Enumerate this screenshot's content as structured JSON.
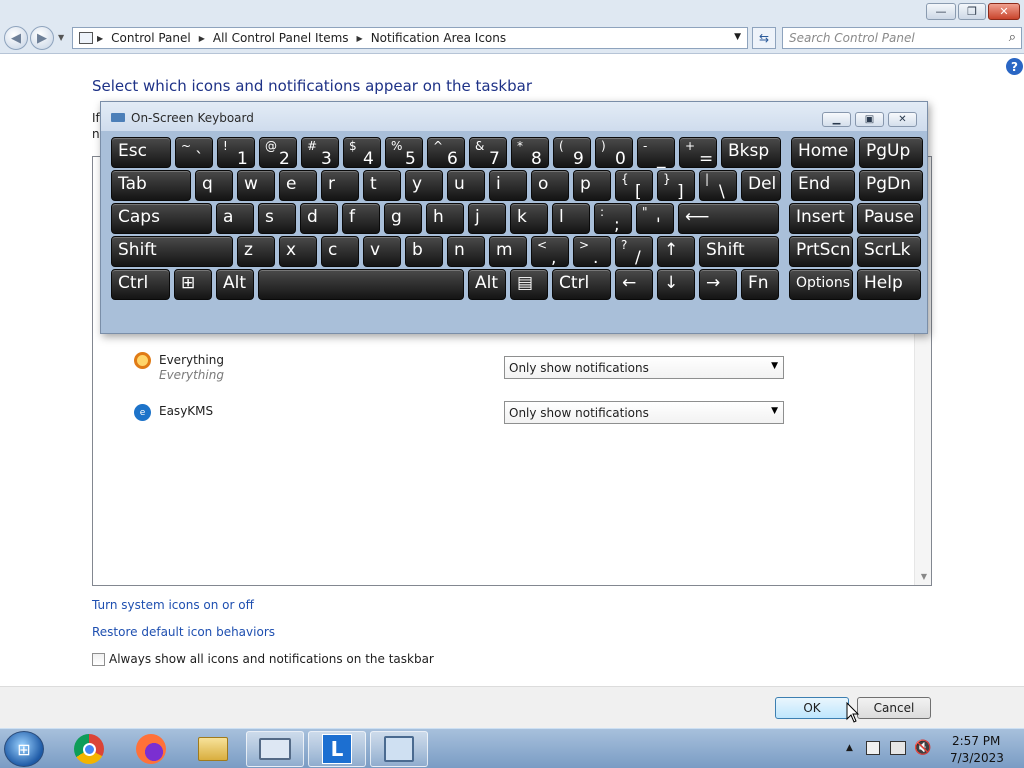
{
  "window": {
    "minimize_glyph": "—",
    "maximize_glyph": "❐",
    "close_glyph": "✕"
  },
  "nav": {
    "breadcrumbs": [
      "Control Panel",
      "All Control Panel Items",
      "Notification Area Icons"
    ],
    "search_placeholder": "Search Control Panel"
  },
  "main": {
    "heading": "Select which icons and notifications appear on the taskbar",
    "hidden_prefix_1": "If",
    "hidden_prefix_2": "n",
    "rows": [
      {
        "name": "Everything",
        "sub": "Everything",
        "behavior": "Only show notifications",
        "icon": "magnifier-icon"
      },
      {
        "name": "EasyKMS",
        "sub": "",
        "behavior": "Only show notifications",
        "icon": "easykms-icon"
      }
    ],
    "links": {
      "system_icons": "Turn system icons on or off",
      "restore_defaults": "Restore default icon behaviors"
    },
    "always_show_label": "Always show all icons and notifications on the taskbar",
    "always_show_checked": false
  },
  "footer": {
    "ok_label": "OK",
    "cancel_label": "Cancel"
  },
  "osk": {
    "title": "On-Screen Keyboard",
    "rows": [
      [
        {
          "l": "Esc",
          "w": 60
        },
        {
          "t": "~",
          "b": "`",
          "w": 38
        },
        {
          "t": "!",
          "b": "1",
          "w": 38
        },
        {
          "t": "@",
          "b": "2",
          "w": 38
        },
        {
          "t": "#",
          "b": "3",
          "w": 38
        },
        {
          "t": "$",
          "b": "4",
          "w": 38
        },
        {
          "t": "%",
          "b": "5",
          "w": 38
        },
        {
          "t": "^",
          "b": "6",
          "w": 38
        },
        {
          "t": "&",
          "b": "7",
          "w": 38
        },
        {
          "t": "*",
          "b": "8",
          "w": 38
        },
        {
          "t": "(",
          "b": "9",
          "w": 38
        },
        {
          "t": ")",
          "b": "0",
          "w": 38
        },
        {
          "t": "-",
          "b": "_",
          "w": 38
        },
        {
          "t": "+",
          "b": "=",
          "w": 38
        },
        {
          "l": "Bksp",
          "w": 60
        },
        {
          "l": "Home",
          "w": 64,
          "gap": 6
        },
        {
          "l": "PgUp",
          "w": 64
        }
      ],
      [
        {
          "l": "Tab",
          "w": 80
        },
        {
          "l": "q",
          "w": 38
        },
        {
          "l": "w",
          "w": 38
        },
        {
          "l": "e",
          "w": 38
        },
        {
          "l": "r",
          "w": 38
        },
        {
          "l": "t",
          "w": 38
        },
        {
          "l": "y",
          "w": 38
        },
        {
          "l": "u",
          "w": 38
        },
        {
          "l": "i",
          "w": 38
        },
        {
          "l": "o",
          "w": 38
        },
        {
          "l": "p",
          "w": 38
        },
        {
          "t": "{",
          "b": "[",
          "w": 38
        },
        {
          "t": "}",
          "b": "]",
          "w": 38
        },
        {
          "t": "|",
          "b": "\\",
          "w": 38
        },
        {
          "l": "Del",
          "w": 40
        },
        {
          "l": "End",
          "w": 64,
          "gap": 6
        },
        {
          "l": "PgDn",
          "w": 64
        }
      ],
      [
        {
          "l": "Caps",
          "w": 101
        },
        {
          "l": "a",
          "w": 38
        },
        {
          "l": "s",
          "w": 38
        },
        {
          "l": "d",
          "w": 38
        },
        {
          "l": "f",
          "w": 38
        },
        {
          "l": "g",
          "w": 38
        },
        {
          "l": "h",
          "w": 38
        },
        {
          "l": "j",
          "w": 38
        },
        {
          "l": "k",
          "w": 38
        },
        {
          "l": "l",
          "w": 38
        },
        {
          "t": ":",
          "b": ";",
          "w": 38
        },
        {
          "t": "\"",
          "b": "'",
          "w": 38
        },
        {
          "l": "⟵",
          "w": 101
        },
        {
          "l": "Insert",
          "w": 64,
          "gap": 6
        },
        {
          "l": "Pause",
          "w": 64
        }
      ],
      [
        {
          "l": "Shift",
          "w": 122
        },
        {
          "l": "z",
          "w": 38
        },
        {
          "l": "x",
          "w": 38
        },
        {
          "l": "c",
          "w": 38
        },
        {
          "l": "v",
          "w": 38
        },
        {
          "l": "b",
          "w": 38
        },
        {
          "l": "n",
          "w": 38
        },
        {
          "l": "m",
          "w": 38
        },
        {
          "t": "<",
          "b": ",",
          "w": 38
        },
        {
          "t": ">",
          "b": ".",
          "w": 38
        },
        {
          "t": "?",
          "b": "/",
          "w": 38
        },
        {
          "l": "↑",
          "w": 38
        },
        {
          "l": "Shift",
          "w": 80
        },
        {
          "l": "PrtScn",
          "w": 64,
          "gap": 6
        },
        {
          "l": "ScrLk",
          "w": 64
        }
      ],
      [
        {
          "l": "Ctrl",
          "w": 59
        },
        {
          "l": "⊞",
          "w": 38
        },
        {
          "l": "Alt",
          "w": 38
        },
        {
          "l": "",
          "w": 206
        },
        {
          "l": "Alt",
          "w": 38
        },
        {
          "l": "▤",
          "w": 38
        },
        {
          "l": "Ctrl",
          "w": 59
        },
        {
          "l": "←",
          "w": 38
        },
        {
          "l": "↓",
          "w": 38
        },
        {
          "l": "→",
          "w": 38
        },
        {
          "l": "Fn",
          "w": 38
        },
        {
          "l": "Options",
          "w": 64,
          "gap": 6,
          "small": true
        },
        {
          "l": "Help",
          "w": 64
        }
      ]
    ]
  },
  "taskbar": {
    "apps": [
      "chrome-icon",
      "firefox-icon",
      "explorer-icon",
      "osk-icon",
      "l-app-icon",
      "control-panel-icon"
    ],
    "l_app_letter": "L",
    "tray_arrow": "▲",
    "time": "2:57 PM",
    "date": "7/3/2023"
  }
}
